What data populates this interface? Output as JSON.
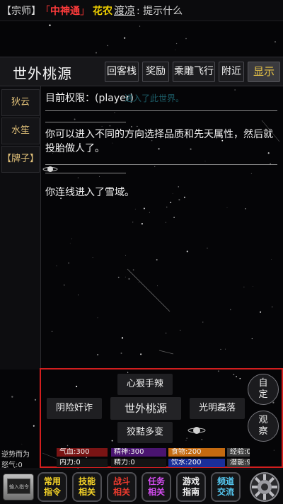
{
  "topline": {
    "rank": "【宗师】",
    "quote_open": "「",
    "title": "中神通",
    "quote_close": "」",
    "player_name": "花农",
    "target_name": "渡凉",
    "message": ": 提示什么"
  },
  "room": {
    "name": "世外桃源",
    "buttons": [
      "回客栈",
      "奖励",
      "乘雕飞行",
      "附近"
    ],
    "show_label": "显示"
  },
  "sidebar": {
    "npcs": [
      "狄云",
      "水笙",
      "【牌子】"
    ]
  },
  "log": {
    "permission": "目前权限：(player)",
    "bg_text": "进入了此世界。",
    "paragraph": "你可以进入不同的方向选择品质和先天属性，然后就投胎做人了。",
    "entered": "你连线进入了雪域。"
  },
  "quick_actions": {
    "north": "心狠手辣",
    "west": "阴险奸诈",
    "center": "世外桃源",
    "east": "光明磊落",
    "south": "狡黠多变",
    "custom": "自定",
    "observe": "观察"
  },
  "stats": {
    "row1_label": "逆势而为",
    "row2_label": "怒气:0",
    "row1": [
      {
        "label": "气血:300",
        "color": "#7a1414"
      },
      {
        "label": "精神:300",
        "color": "#4a1470"
      },
      {
        "label": "食物:200",
        "color": "#c46a10"
      },
      {
        "label": "经验:0",
        "color": "#3c3c3c"
      }
    ],
    "row2": [
      {
        "label": "内力:0",
        "color": "#141414"
      },
      {
        "label": "精力:0",
        "color": "#141414"
      },
      {
        "label": "饮水:200",
        "color": "#1a2f9a"
      },
      {
        "label": "潜能:99",
        "color": "#3c3c3c"
      }
    ]
  },
  "bottom": {
    "input_label": "输入指令",
    "nav": [
      {
        "line1": "常用",
        "line2": "指令",
        "color": "#f5d327"
      },
      {
        "line1": "技能",
        "line2": "相关",
        "color": "#f5d327"
      },
      {
        "line1": "战斗",
        "line2": "相关",
        "color": "#ef3b2e"
      },
      {
        "line1": "任务",
        "line2": "相关",
        "color": "#d44cf0"
      },
      {
        "line1": "游戏",
        "line2": "指南",
        "color": "#f2f2f2"
      },
      {
        "line1": "频道",
        "line2": "交流",
        "color": "#55c7f0"
      }
    ],
    "gear_icon": "settings-gear-icon"
  }
}
